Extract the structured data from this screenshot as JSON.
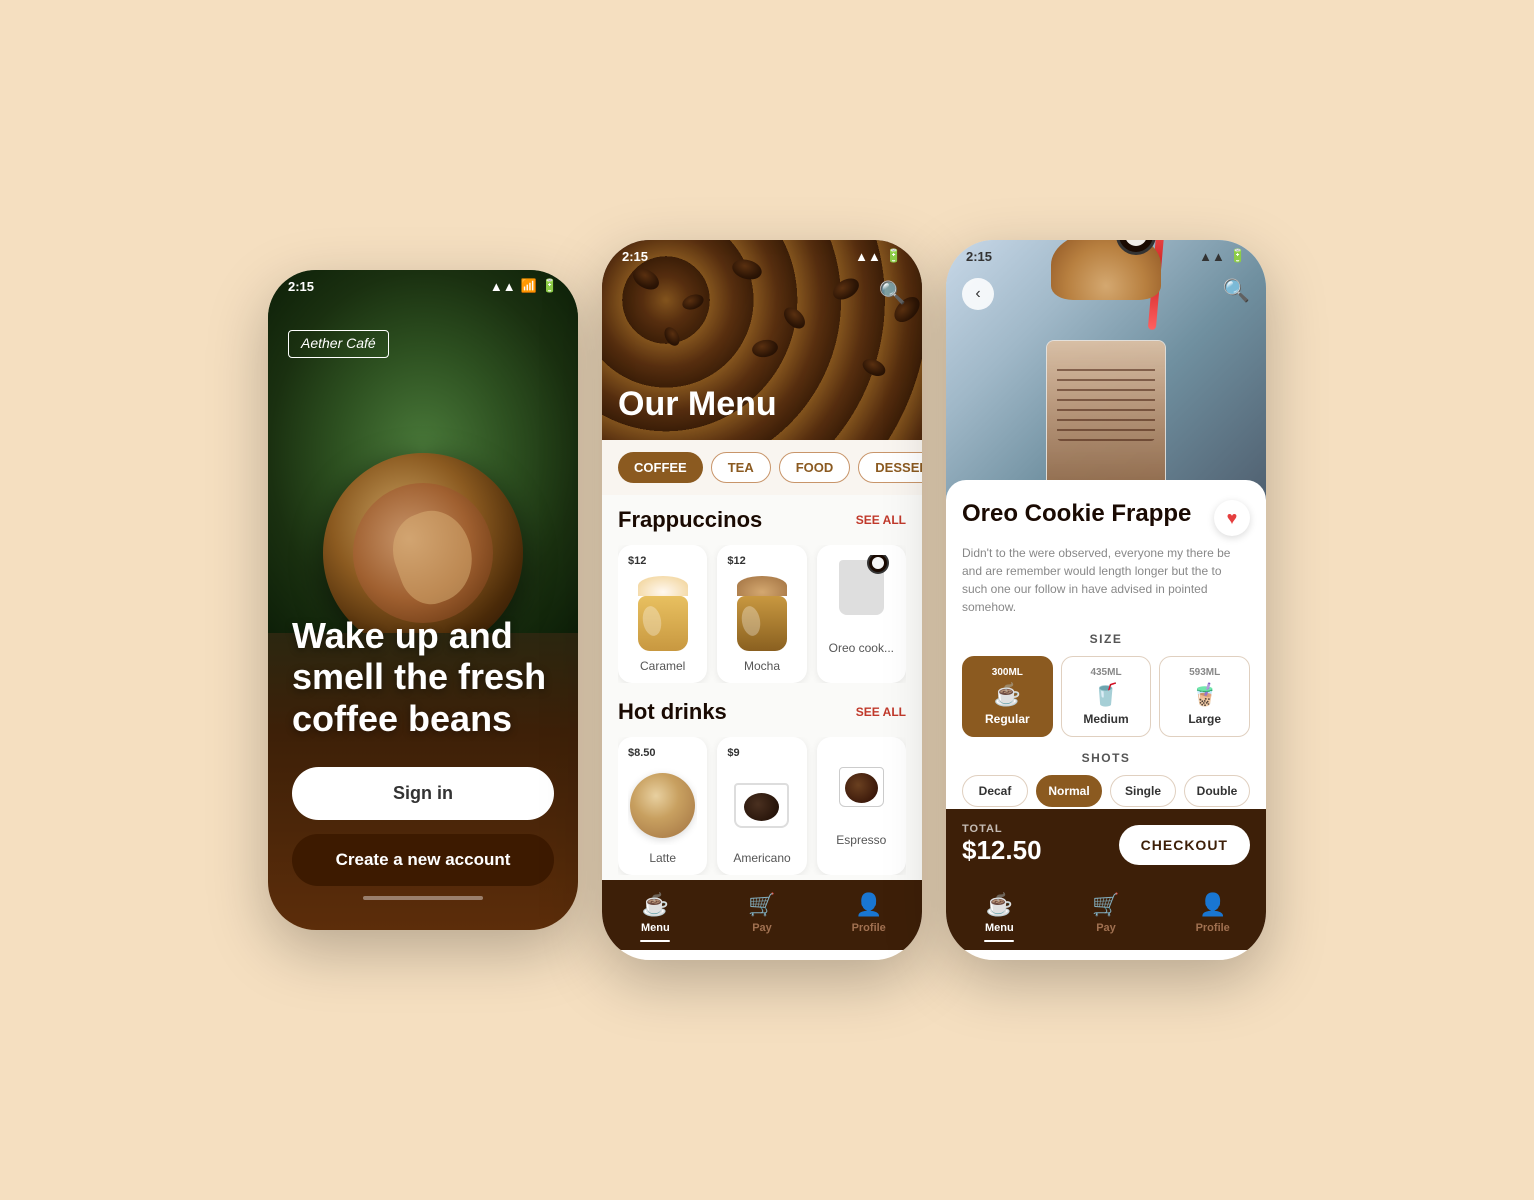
{
  "screen1": {
    "time": "2:15",
    "brand": "Aether Café",
    "headline": "Wake up and smell the fresh coffee beans",
    "signin_label": "Sign in",
    "create_label": "Create a new account"
  },
  "screen2": {
    "time": "2:15",
    "title": "Our Menu",
    "categories": [
      "COFFEE",
      "TEA",
      "FOOD",
      "DESSERT"
    ],
    "active_category": "COFFEE",
    "sections": [
      {
        "name": "Frappuccinos",
        "see_all": "SEE ALL",
        "items": [
          {
            "name": "Caramel",
            "price": "$12"
          },
          {
            "name": "Mocha",
            "price": "$12"
          },
          {
            "name": "Oreo cook...",
            "price": ""
          }
        ]
      },
      {
        "name": "Hot drinks",
        "see_all": "SEE ALL",
        "items": [
          {
            "name": "Latte",
            "price": "$8.50"
          },
          {
            "name": "Americano",
            "price": "$9"
          },
          {
            "name": "Espresso",
            "price": ""
          }
        ]
      }
    ],
    "nav": [
      {
        "label": "Menu",
        "active": true
      },
      {
        "label": "Pay",
        "active": false
      },
      {
        "label": "Profile",
        "active": false
      }
    ]
  },
  "screen3": {
    "time": "2:15",
    "product_name": "Oreo Cookie Frappe",
    "product_desc": "Didn't to the were observed, everyone my there be and are remember would length longer but the to such one our follow in have advised in pointed somehow.",
    "size_label": "SIZE",
    "sizes": [
      {
        "ml": "300ML",
        "name": "Regular",
        "selected": true
      },
      {
        "ml": "435ML",
        "name": "Medium",
        "selected": false
      },
      {
        "ml": "593ML",
        "name": "Large",
        "selected": false
      }
    ],
    "shots_label": "SHOTS",
    "shots": [
      {
        "name": "Decaf",
        "selected": false
      },
      {
        "name": "Normal",
        "selected": true
      },
      {
        "name": "Single",
        "selected": false
      },
      {
        "name": "Double",
        "selected": false
      }
    ],
    "total_label": "TOTAL",
    "total_price": "$12.50",
    "checkout_label": "CHECKOUT",
    "nav": [
      {
        "label": "Menu",
        "active": true
      },
      {
        "label": "Pay",
        "active": false
      },
      {
        "label": "Profile",
        "active": false
      }
    ]
  }
}
